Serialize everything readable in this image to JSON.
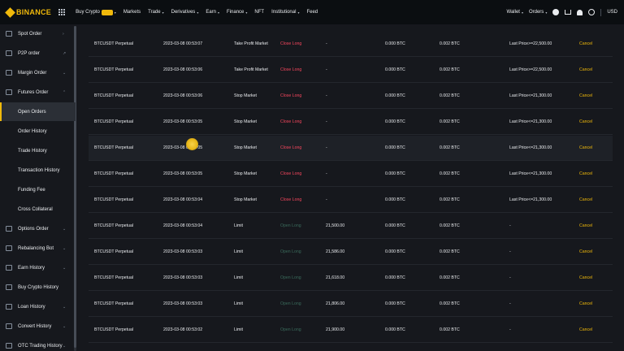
{
  "header": {
    "logo_text": "BINANCE",
    "nav": [
      {
        "label": "Buy Crypto",
        "caret": "▾"
      },
      {
        "label": "Markets",
        "caret": ""
      },
      {
        "label": "Trade",
        "caret": "▾"
      },
      {
        "label": "Derivatives",
        "caret": "▾"
      },
      {
        "label": "Earn",
        "caret": "▾"
      },
      {
        "label": "Finance",
        "caret": "▾"
      },
      {
        "label": "NFT",
        "caret": ""
      },
      {
        "label": "Institutional",
        "caret": "▾"
      },
      {
        "label": "Feed",
        "caret": ""
      }
    ],
    "right": {
      "wallet": "Wallet",
      "orders": "Orders",
      "currency": "USD",
      "caret": "▾"
    },
    "accent": "#f0b90b"
  },
  "sidebar": {
    "items": [
      {
        "label": "Spot Order",
        "icon": "document-icon",
        "chev": "›",
        "sub": false
      },
      {
        "label": "P2P order",
        "icon": "p2p-icon",
        "chev": "↗",
        "sub": false
      },
      {
        "label": "Margin Order",
        "icon": "margin-icon",
        "chev": "⌄",
        "sub": false
      },
      {
        "label": "Futures Order",
        "icon": "futures-icon",
        "chev": "⌃",
        "sub": false
      },
      {
        "label": "Open Orders",
        "icon": "",
        "chev": "",
        "sub": true,
        "active": true
      },
      {
        "label": "Order History",
        "icon": "",
        "chev": "",
        "sub": true
      },
      {
        "label": "Trade History",
        "icon": "",
        "chev": "",
        "sub": true
      },
      {
        "label": "Transaction History",
        "icon": "",
        "chev": "",
        "sub": true
      },
      {
        "label": "Funding Fee",
        "icon": "",
        "chev": "",
        "sub": true
      },
      {
        "label": "Cross Collateral",
        "icon": "",
        "chev": "",
        "sub": true
      },
      {
        "label": "Options Order",
        "icon": "options-icon",
        "chev": "⌄",
        "sub": false
      },
      {
        "label": "Rebalancing Bot",
        "icon": "bot-icon",
        "chev": "⌄",
        "sub": false
      },
      {
        "label": "Earn History",
        "icon": "earn-icon",
        "chev": "⌄",
        "sub": false
      },
      {
        "label": "Buy Crypto History",
        "icon": "buy-crypto-icon",
        "chev": "",
        "sub": false
      },
      {
        "label": "Loan History",
        "icon": "loan-icon",
        "chev": "⌄",
        "sub": false
      },
      {
        "label": "Convert History",
        "icon": "convert-icon",
        "chev": "⌄",
        "sub": false
      },
      {
        "label": "OTC Trading History",
        "icon": "otc-icon",
        "chev": "⌄",
        "sub": false
      }
    ]
  },
  "orders": {
    "rows": [
      {
        "symbol": "BTCUSDT Perpetual",
        "time": "2023-03-08 00:53:07",
        "type": "Take Profit Market",
        "side": "Close Long",
        "side_kind": "close",
        "price": "-",
        "filled": "0.000 BTC",
        "amount": "0.002 BTC",
        "trigger": "Last Price>=22,500.00",
        "action": "Cancel"
      },
      {
        "symbol": "BTCUSDT Perpetual",
        "time": "2023-03-08 00:53:06",
        "type": "Take Profit Market",
        "side": "Close Long",
        "side_kind": "close",
        "price": "-",
        "filled": "0.000 BTC",
        "amount": "0.002 BTC",
        "trigger": "Last Price>=22,500.00",
        "action": "Cancel"
      },
      {
        "symbol": "BTCUSDT Perpetual",
        "time": "2023-03-08 00:53:06",
        "type": "Stop Market",
        "side": "Close Long",
        "side_kind": "close",
        "price": "-",
        "filled": "0.000 BTC",
        "amount": "0.002 BTC",
        "trigger": "Last Price<=21,300.00",
        "action": "Cancel"
      },
      {
        "symbol": "BTCUSDT Perpetual",
        "time": "2023-03-08 00:53:05",
        "type": "Stop Market",
        "side": "Close Long",
        "side_kind": "close",
        "price": "-",
        "filled": "0.000 BTC",
        "amount": "0.002 BTC",
        "trigger": "Last Price<=21,300.00",
        "action": "Cancel"
      },
      {
        "symbol": "BTCUSDT Perpetual",
        "time": "2023-03-08 00:53:05",
        "type": "Stop Market",
        "side": "Close Long",
        "side_kind": "close",
        "price": "-",
        "filled": "0.000 BTC",
        "amount": "0.002 BTC",
        "trigger": "Last Price<=21,300.00",
        "action": "Cancel",
        "hover": true
      },
      {
        "symbol": "BTCUSDT Perpetual",
        "time": "2023-03-08 00:53:05",
        "type": "Stop Market",
        "side": "Close Long",
        "side_kind": "close",
        "price": "-",
        "filled": "0.000 BTC",
        "amount": "0.002 BTC",
        "trigger": "Last Price<=21,300.00",
        "action": "Cancel"
      },
      {
        "symbol": "BTCUSDT Perpetual",
        "time": "2023-03-08 00:53:04",
        "type": "Stop Market",
        "side": "Close Long",
        "side_kind": "close",
        "price": "-",
        "filled": "0.000 BTC",
        "amount": "0.002 BTC",
        "trigger": "Last Price<=21,300.00",
        "action": "Cancel"
      },
      {
        "symbol": "BTCUSDT Perpetual",
        "time": "2023-03-08 00:53:04",
        "type": "Limit",
        "side": "Open Long",
        "side_kind": "open",
        "price": "21,500.00",
        "filled": "0.000 BTC",
        "amount": "0.002 BTC",
        "trigger": "-",
        "action": "Cancel"
      },
      {
        "symbol": "BTCUSDT Perpetual",
        "time": "2023-03-08 00:53:03",
        "type": "Limit",
        "side": "Open Long",
        "side_kind": "open",
        "price": "21,586.00",
        "filled": "0.000 BTC",
        "amount": "0.002 BTC",
        "trigger": "-",
        "action": "Cancel"
      },
      {
        "symbol": "BTCUSDT Perpetual",
        "time": "2023-03-08 00:53:03",
        "type": "Limit",
        "side": "Open Long",
        "side_kind": "open",
        "price": "21,618.00",
        "filled": "0.000 BTC",
        "amount": "0.002 BTC",
        "trigger": "-",
        "action": "Cancel"
      },
      {
        "symbol": "BTCUSDT Perpetual",
        "time": "2023-03-08 00:53:03",
        "type": "Limit",
        "side": "Open Long",
        "side_kind": "open",
        "price": "21,806.00",
        "filled": "0.000 BTC",
        "amount": "0.002 BTC",
        "trigger": "-",
        "action": "Cancel"
      },
      {
        "symbol": "BTCUSDT Perpetual",
        "time": "2023-03-08 00:53:02",
        "type": "Limit",
        "side": "Open Long",
        "side_kind": "open",
        "price": "21,900.00",
        "filled": "0.000 BTC",
        "amount": "0.002 BTC",
        "trigger": "-",
        "action": "Cancel"
      }
    ]
  },
  "colors": {
    "close_side": "#f6465d",
    "open_side": "#3a6b5b",
    "cancel": "#f0b90b",
    "background": "#16181d"
  }
}
